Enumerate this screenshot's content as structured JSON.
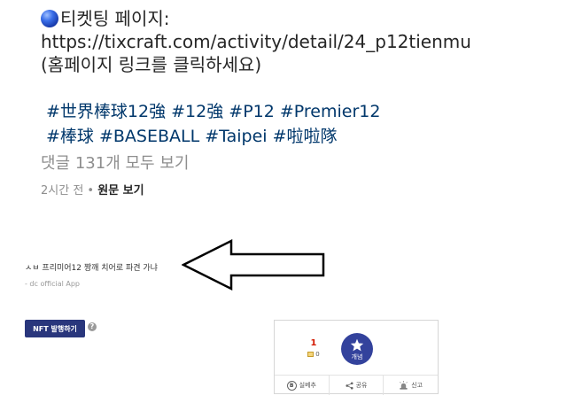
{
  "post": {
    "ticket_label": "티켓팅 페이지:",
    "ticket_url": "https://tixcraft.com/activity/detail/24_p12tienmu",
    "link_note": "(홈페이지 링크를 클릭하세요)",
    "hashtags_line1": "#世界棒球12強 #12強 #P12 #Premier12",
    "hashtags_line2": "#棒球 #BASEBALL #Taipei #啦啦隊",
    "comments_link": "댓글 131개 모두 보기",
    "time_ago": "2시간 전",
    "separator": " • ",
    "original_link": "원문 보기"
  },
  "caption": "ㅅㅂ 프리미어12 짱깨 치어로 파견 가냐",
  "app_signature": "- dc official App",
  "nft_button": "NFT 발행하기",
  "help_icon_glyph": "?",
  "recommend": {
    "upvote_count": "1",
    "fix_count": "0",
    "star_label": "개념",
    "buttons": [
      {
        "label": "실베추",
        "icon": "b-circle-icon",
        "glyph": "B"
      },
      {
        "label": "공유",
        "icon": "share-icon"
      },
      {
        "label": "신고",
        "icon": "siren-icon"
      }
    ]
  },
  "colors": {
    "hashtag": "#00376b",
    "nft_button_bg": "#29367c",
    "star_button_bg": "#33429c",
    "upvote": "#d31900"
  },
  "icons": [
    "blue-ball-icon",
    "left-arrow-icon",
    "help-icon",
    "fix-icon",
    "star-icon",
    "b-circle-icon",
    "share-icon",
    "siren-icon"
  ]
}
